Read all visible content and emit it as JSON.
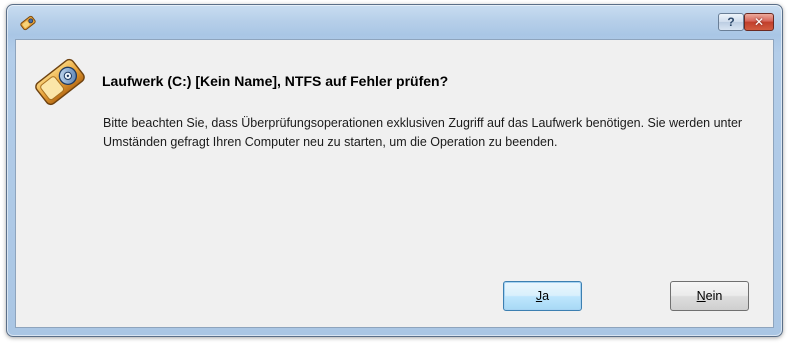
{
  "titlebar": {
    "app_icon": "app-drive-icon",
    "help_glyph": "?",
    "close_glyph": "✕"
  },
  "dialog": {
    "icon": "drive-check-icon",
    "heading": "Laufwerk (C:) [Kein Name], NTFS auf Fehler prüfen?",
    "body": "Bitte beachten Sie, dass Überprüfungsoperationen exklusiven Zugriff auf das Laufwerk benötigen. Sie werden unter Umständen gefragt Ihren Computer neu zu starten, um die Operation zu beenden."
  },
  "buttons": {
    "yes_mnemonic": "J",
    "yes_rest": "a",
    "no_mnemonic": "N",
    "no_rest": "ein"
  },
  "colors": {
    "frame": "#a9c6e5",
    "client": "#f0f0f0",
    "close": "#c13e2b",
    "accent": "#e8a33a"
  }
}
